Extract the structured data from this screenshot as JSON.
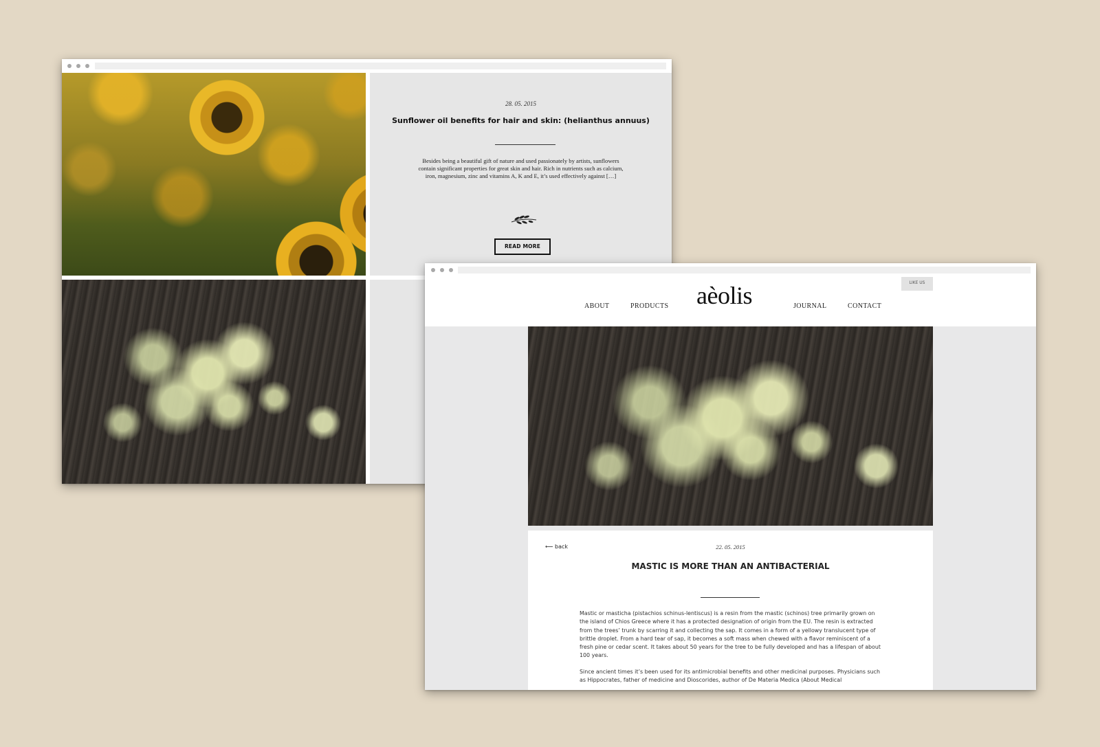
{
  "window1": {
    "post": {
      "date": "28. 05. 2015",
      "title": "Sunflower oil benefits for hair and skin: (helianthus annuus)",
      "excerpt": "Besides being a beautiful gift of nature and used passionately by artists, sunflowers contain significant properties for great skin and hair. Rich in nutrients such as calcium, iron, magnesium, zinc and vitamins A, K and E, it’s used effectively against […]",
      "icon": "olive-branch-icon",
      "read_more_label": "READ MORE"
    },
    "images": [
      "sunflower-photo",
      "mastic-resin-photo"
    ]
  },
  "window2": {
    "nav": {
      "about": "ABOUT",
      "products": "PRODUCTS",
      "logo": "aèolis",
      "journal": "JOURNAL",
      "contact": "CONTACT",
      "like_us": "LIKE US"
    },
    "article": {
      "back_label": "back",
      "date": "22. 05. 2015",
      "title": "MASTIC IS MORE THAN AN ANTIBACTERIAL",
      "paragraph1": "Mastic or masticha (pistachios schinus-lentiscus) is a resin from the mastic (schinos) tree primarily grown on the island of Chios Greece where it has a protected designation of origin from the EU. The resin is extracted from the trees’ trunk by scarring it and collecting the sap. It comes in a form of a yellowy translucent type of brittle droplet. From a hard tear of sap, it becomes a soft mass when chewed with a flavor reminiscent of a fresh pine or cedar scent. It takes about 50 years for the tree to be fully developed and has a lifespan of about 100 years.",
      "paragraph2": "Since ancient times it’s been used for its antimicrobial benefits and other medicinal purposes. Physicians such as Hippocrates, father of medicine and Dioscorides, author of De Materia Medica (About Medical"
    }
  },
  "colors": {
    "background": "#e3d8c5",
    "panel_gray": "#e6e6e6",
    "text_dark": "#111111"
  }
}
